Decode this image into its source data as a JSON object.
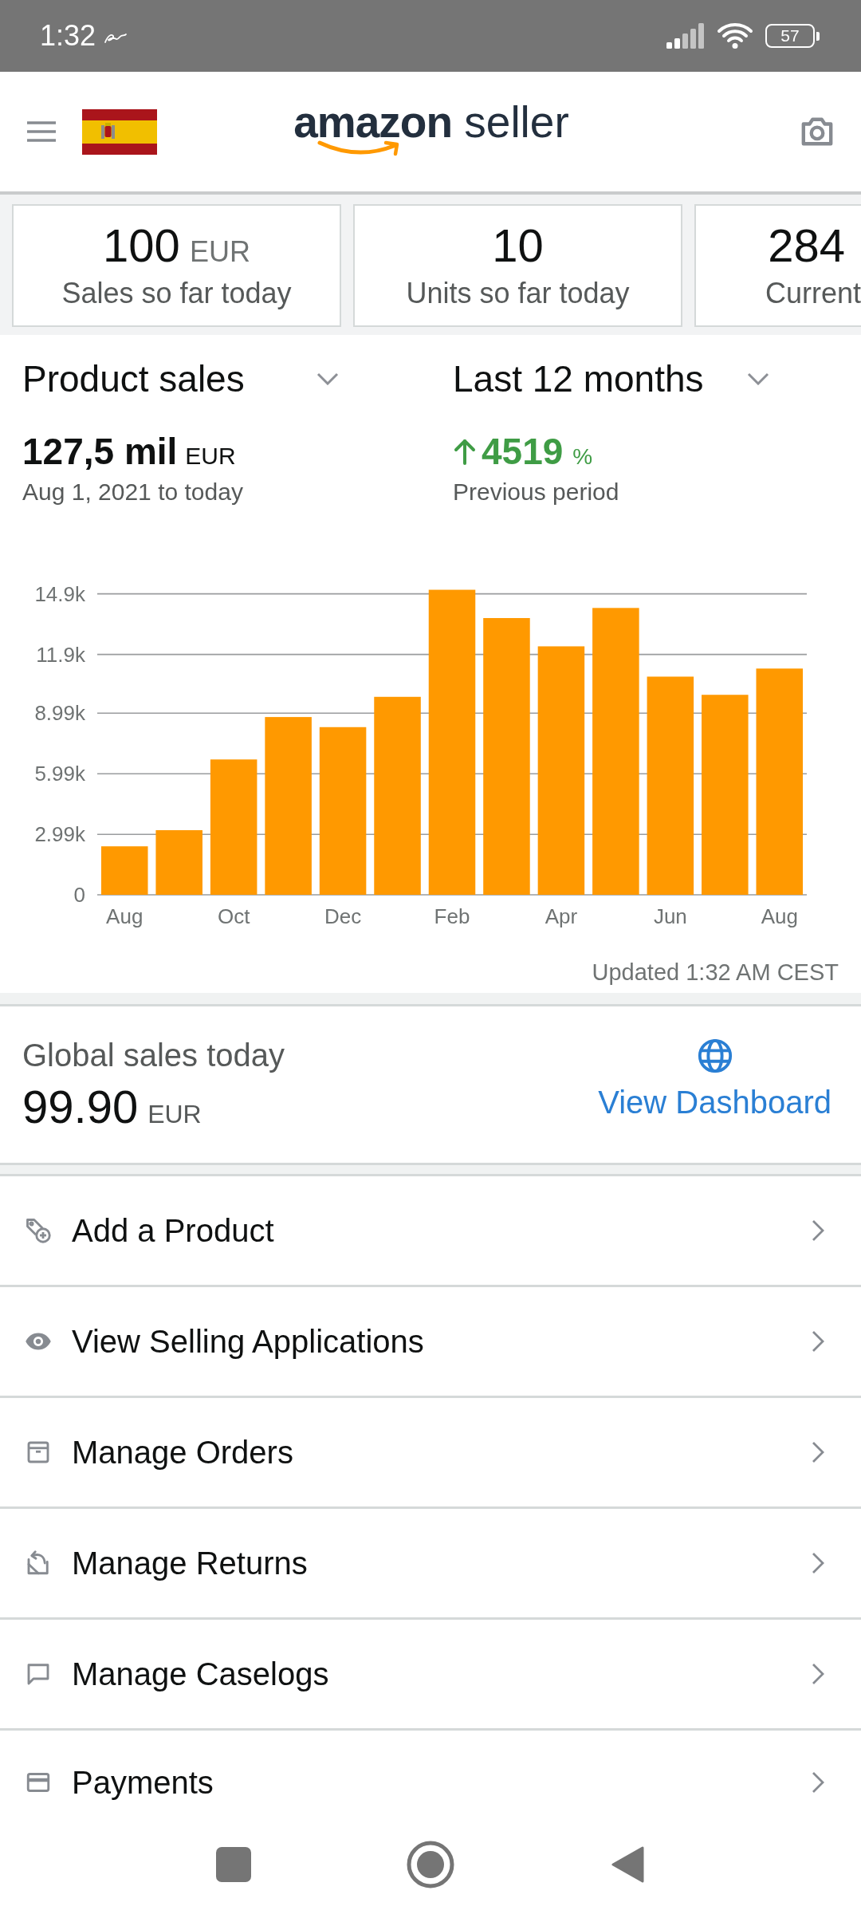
{
  "status_bar": {
    "time": "1:32",
    "battery": "57"
  },
  "header": {
    "logo": "**amazon** seller"
  },
  "metric_cards": [
    {
      "value": "100",
      "unit": "EUR",
      "label": "Sales so far today"
    },
    {
      "value": "10",
      "label": "Units so far today"
    },
    {
      "value": "284",
      "label": "Current"
    }
  ],
  "sales_summary": {
    "metric_dropdown": "Product sales",
    "period_dropdown": "Last 12 months",
    "total": "127,5 mil",
    "total_unit": "EUR",
    "date_range": "Aug 1, 2021 to today",
    "change_positive": true,
    "change": "4519",
    "change_unit": "%",
    "change_label": "Previous period",
    "chart_data": {
      "type": "bar",
      "categories": [
        "Aug",
        null,
        "Oct",
        null,
        "Dec",
        null,
        "Feb",
        null,
        "Apr",
        null,
        "Jun",
        null,
        "Aug"
      ],
      "values": [
        2400,
        3200,
        6700,
        8800,
        8300,
        9800,
        15100,
        13700,
        12300,
        14200,
        10800,
        9900,
        11200
      ],
      "yticks": [
        0,
        {
          "value": 2990,
          "label": "2.99k"
        },
        {
          "value": 5990,
          "label": "5.99k"
        },
        {
          "value": 8990,
          "label": "8.99k"
        },
        {
          "value": 11900,
          "label": "11.9k"
        },
        {
          "value": 14900,
          "label": "14.9k"
        }
      ],
      "ylim": [
        0,
        15200
      ],
      "grid": true
    },
    "updated": "Updated 1:32 AM CEST"
  },
  "global_sales": {
    "label": "Global sales today",
    "value": "99.90",
    "unit": "EUR",
    "link": "View Dashboard"
  },
  "menu": [
    "Add a Product",
    "View Selling Applications",
    "Manage Orders",
    "Manage Returns",
    "Manage Caselogs",
    "Payments"
  ]
}
